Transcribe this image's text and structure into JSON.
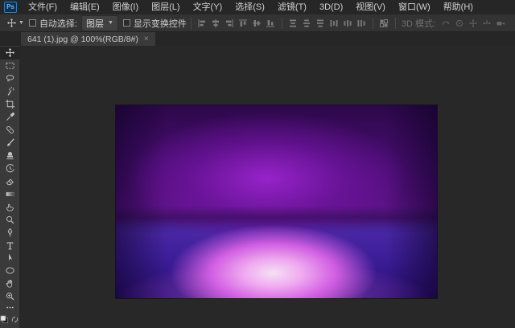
{
  "app_logo": {
    "text": "Ps"
  },
  "menubar": {
    "items": [
      "文件(F)",
      "编辑(E)",
      "图像(I)",
      "图层(L)",
      "文字(Y)",
      "选择(S)",
      "滤镜(T)",
      "3D(D)",
      "视图(V)",
      "窗口(W)",
      "帮助(H)"
    ]
  },
  "options_bar": {
    "active_tool": "move",
    "auto_select": {
      "label": "自动选择:",
      "checked": false,
      "value": "图层"
    },
    "show_transform": {
      "label": "显示变换控件",
      "checked": false
    },
    "align_icons": [
      "align-left-icon",
      "align-center-h-icon",
      "align-right-icon",
      "align-top-icon",
      "align-middle-v-icon",
      "align-bottom-icon",
      "distribute-top-icon",
      "distribute-middle-icon",
      "distribute-bottom-icon",
      "distribute-left-icon",
      "distribute-center-icon",
      "distribute-right-icon",
      "auto-align-icon"
    ],
    "mode_3d_label": "3D 模式:",
    "mode_3d_icons": [
      "orbit-3d-icon",
      "roll-3d-icon",
      "pan-3d-icon",
      "slide-3d-icon",
      "dolly-3d-icon"
    ]
  },
  "tab": {
    "title": "641 (1).jpg @ 100%(RGB/8#)",
    "close_glyph": "×",
    "file_name": "641 (1).jpg",
    "zoom_percent": "100%",
    "color_mode": "RGB/8#",
    "active": true
  },
  "tools": [
    {
      "name": "move",
      "selected": true
    },
    {
      "name": "marquee",
      "selected": false
    },
    {
      "name": "lasso",
      "selected": false
    },
    {
      "name": "magic-wand",
      "selected": false
    },
    {
      "name": "crop",
      "selected": false
    },
    {
      "name": "eyedropper",
      "selected": false
    },
    {
      "name": "healing-brush",
      "selected": false
    },
    {
      "name": "brush",
      "selected": false
    },
    {
      "name": "clone-stamp",
      "selected": false
    },
    {
      "name": "history-brush",
      "selected": false
    },
    {
      "name": "eraser",
      "selected": false
    },
    {
      "name": "gradient",
      "selected": false
    },
    {
      "name": "smudge",
      "selected": false
    },
    {
      "name": "dodge",
      "selected": false
    },
    {
      "name": "pen",
      "selected": false
    },
    {
      "name": "type",
      "selected": false
    },
    {
      "name": "path-select",
      "selected": false
    },
    {
      "name": "shape-ellipse",
      "selected": false
    },
    {
      "name": "hand",
      "selected": false
    },
    {
      "name": "zoom",
      "selected": false
    },
    {
      "name": "edit-toolbar-ellipsis",
      "selected": false
    },
    {
      "name": "foreground-background-colors",
      "selected": false
    }
  ],
  "document": {
    "type": "image",
    "description": "Purple studio backdrop photo: dark purple wall with magenta glow, horizon line, bright pink radial light on floor, indigo corners",
    "palette": {
      "top_corner": "#2c0849",
      "wall_glow": "#9a24cd",
      "horizon_shadow": "#3f0a63",
      "floor_glow_center": "#f6e0f4",
      "floor_glow_mid": "#d25fe3",
      "floor_corner": "#2b0f74"
    }
  }
}
